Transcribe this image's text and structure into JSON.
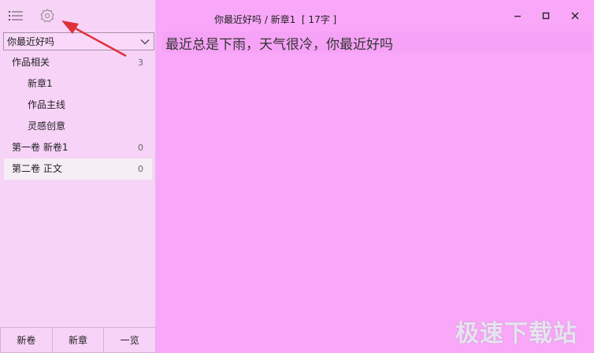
{
  "sidebar": {
    "book_selector": {
      "value": "你最近好吗"
    },
    "tree": [
      {
        "label": "作品相关",
        "count": "3",
        "level": 0
      },
      {
        "label": "新章1",
        "level": 1
      },
      {
        "label": "作品主线",
        "level": 1
      },
      {
        "label": "灵感创意",
        "level": 1
      },
      {
        "label": "第一卷  新卷1",
        "count": "0",
        "level": 0
      },
      {
        "label": "第二卷  正文",
        "count": "0",
        "level": 0,
        "selected": true
      }
    ],
    "buttons": {
      "new_volume": "新卷",
      "new_chapter": "新章",
      "overview": "一览"
    }
  },
  "header": {
    "title": "你最近好吗 / 新章1  [ 17字 ]"
  },
  "editor": {
    "text": "最近总是下雨，天气很冷，你最近好吗"
  },
  "watermark": "极速下载站",
  "colors": {
    "main_bg": "#f9a8f9",
    "sidebar_bg": "#f8d3f8",
    "arrow": "#e0303a"
  }
}
